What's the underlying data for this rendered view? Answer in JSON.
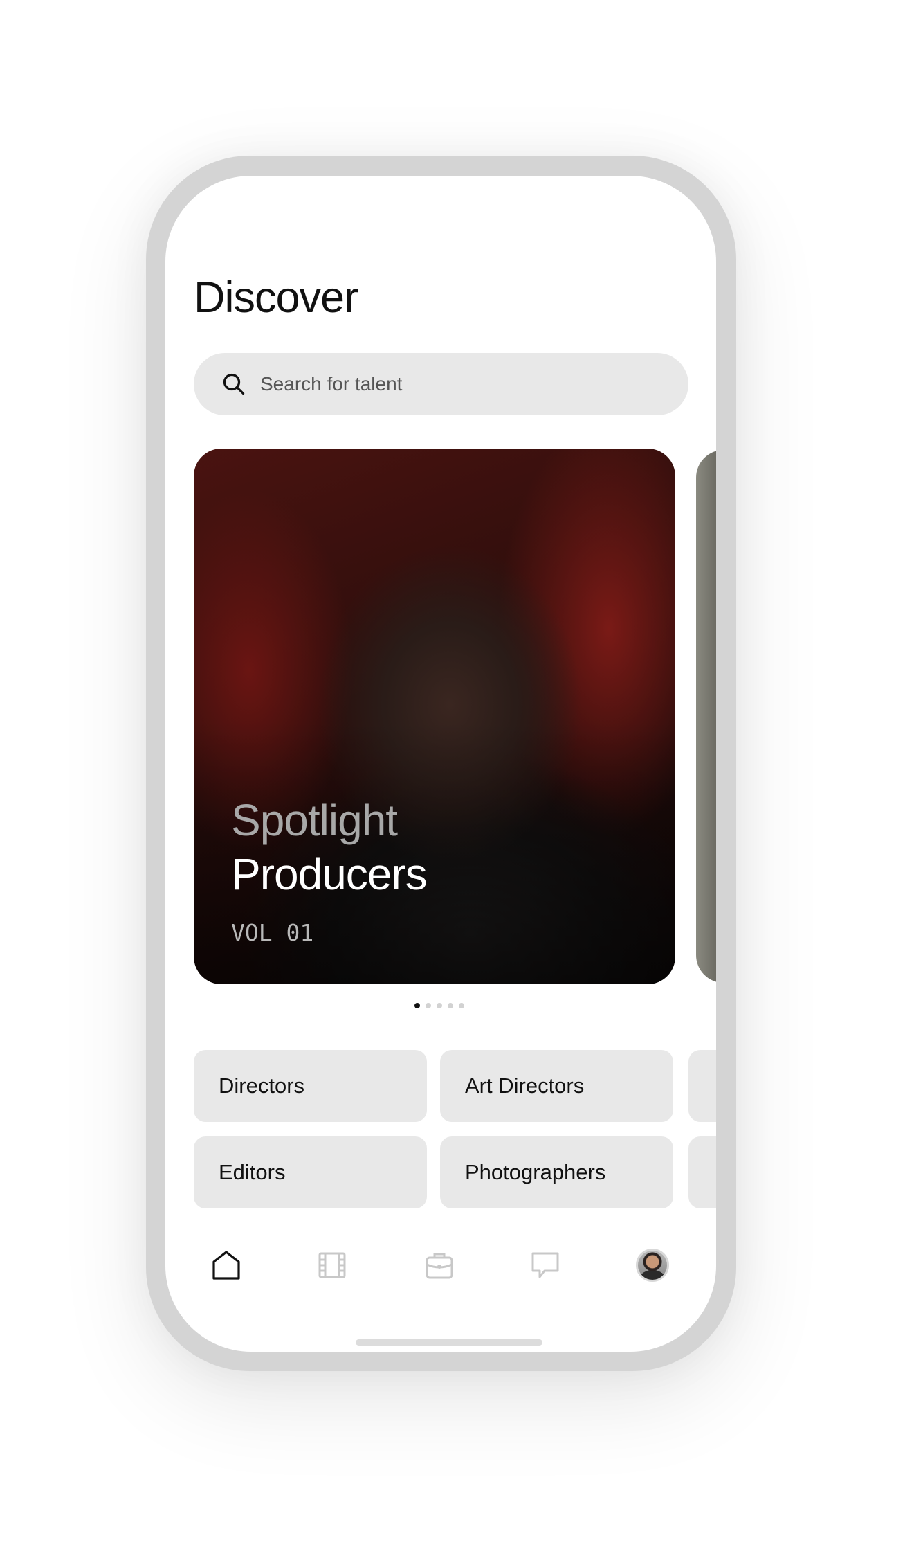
{
  "header": {
    "title": "Discover"
  },
  "search": {
    "placeholder": "Search for talent",
    "icon": "search-icon"
  },
  "spotlight": {
    "kicker": "Spotlight",
    "heading": "Producers",
    "volume": "VOL 01",
    "carousel_pages": 5,
    "active_page": 1
  },
  "categories": [
    {
      "label": "Directors"
    },
    {
      "label": "Art Directors"
    },
    {
      "label": "Editors"
    },
    {
      "label": "Photographers"
    }
  ],
  "bottom_nav": {
    "items": [
      {
        "icon": "home-icon",
        "active": true
      },
      {
        "icon": "film-icon",
        "active": false
      },
      {
        "icon": "briefcase-icon",
        "active": false
      },
      {
        "icon": "chat-icon",
        "active": false
      },
      {
        "icon": "profile-avatar",
        "active": false
      }
    ]
  },
  "colors": {
    "active_icon": "#111111",
    "inactive_icon": "#c8c8c8",
    "tile_bg": "#e8e8e8",
    "frame": "#d4d4d4"
  }
}
